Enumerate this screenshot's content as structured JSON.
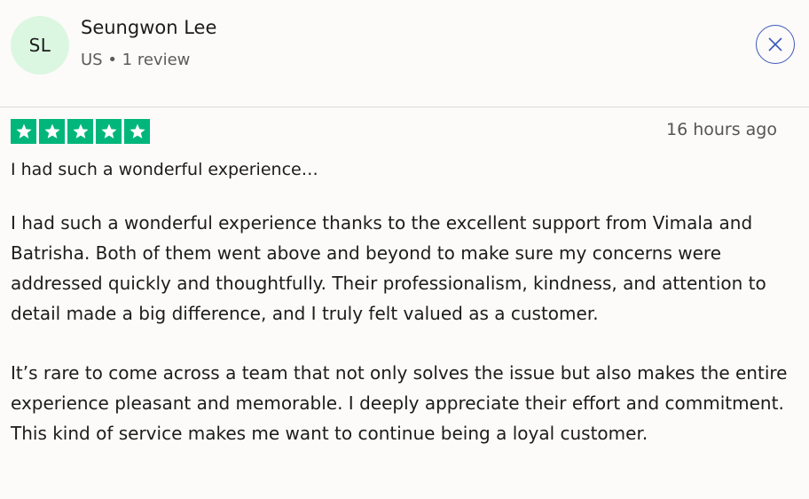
{
  "reviewer": {
    "initials": "SL",
    "name": "Seungwon Lee",
    "meta": "US • 1 review"
  },
  "close_icon": "close-icon",
  "review": {
    "rating": 5,
    "max_rating": 5,
    "star_color": "#00b67a",
    "date": "16 hours ago",
    "title": "I had such a wonderful experience…",
    "paragraphs": [
      "I had such a wonderful experience thanks to the excellent support from Vimala and Batrisha. Both of them went above and beyond to make sure my concerns were addressed quickly and thoughtfully. Their professionalism, kindness, and attention to detail made a big difference, and I truly felt valued as a customer.",
      "It’s rare to come across a team that not only solves the issue but also makes the entire experience pleasant and memorable. I deeply appreciate their effort and commitment. This kind of service makes me want to continue being a loyal customer."
    ]
  },
  "colors": {
    "avatar_bg": "#dcf7e1",
    "accent": "#3c57bc"
  }
}
